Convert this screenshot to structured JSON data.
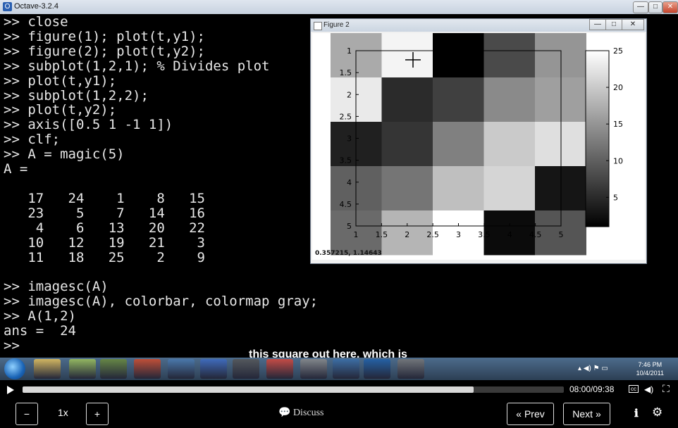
{
  "window": {
    "title": "Octave-3.2.4",
    "buttons": [
      "—",
      "□",
      "✕"
    ]
  },
  "console": {
    "lines": [
      ">> close",
      ">> figure(1); plot(t,y1);",
      ">> figure(2); plot(t,y2);",
      ">> subplot(1,2,1); % Divides plot",
      ">> plot(t,y1);",
      ">> subplot(1,2,2);",
      ">> plot(t,y2);",
      ">> axis([0.5 1 -1 1])",
      ">> clf;",
      ">> A = magic(5)",
      "A =",
      "",
      "   17   24    1    8   15",
      "   23    5    7   14   16",
      "    4    6   13   20   22",
      "   10   12   19   21    3",
      "   11   18   25    2    9",
      "",
      ">> imagesc(A)",
      ">> imagesc(A), colorbar, colormap gray;",
      ">> A(1,2)",
      "ans =  24",
      ">>"
    ]
  },
  "figure": {
    "title": "Figure 2",
    "buttons": [
      "—",
      "□",
      "✕"
    ],
    "coords": "0.357215, 1.14643",
    "matrix": [
      [
        17,
        24,
        1,
        8,
        15
      ],
      [
        23,
        5,
        7,
        14,
        16
      ],
      [
        4,
        6,
        13,
        20,
        22
      ],
      [
        10,
        12,
        19,
        21,
        3
      ],
      [
        11,
        18,
        25,
        2,
        9
      ]
    ],
    "y_ticks": [
      "1",
      "1.5",
      "2",
      "2.5",
      "3",
      "3.5",
      "4",
      "4.5",
      "5"
    ],
    "x_ticks": [
      "1",
      "1.5",
      "2",
      "2.5",
      "3",
      "3.5",
      "4",
      "4.5",
      "5"
    ],
    "colorbar_ticks": [
      "25",
      "20",
      "15",
      "10",
      "5"
    ],
    "colorbar_values": [
      25,
      20,
      15,
      10,
      5
    ],
    "value_range": [
      1,
      25
    ],
    "colormap": "gray"
  },
  "caption": "this square out here, which is",
  "taskbar": {
    "icons": [
      "folder-icon",
      "notes-icon",
      "app-icon",
      "powerpoint-icon",
      "network-icon",
      "remote-icon",
      "camera-icon",
      "chrome-icon",
      "webcam-icon",
      "python-icon",
      "media-icon",
      "chart-icon"
    ],
    "clock_time": "7:46 PM",
    "clock_date": "10/4/2011"
  },
  "player": {
    "progress": 0.833,
    "current_time": "08:00",
    "total_time": "09:38",
    "time_separator": "/",
    "cc_label": "cc",
    "speed": "1x",
    "minus_label": "−",
    "plus_label": "+",
    "discuss_label": "Discuss",
    "prev_label": "« Prev",
    "next_label": "Next »"
  }
}
